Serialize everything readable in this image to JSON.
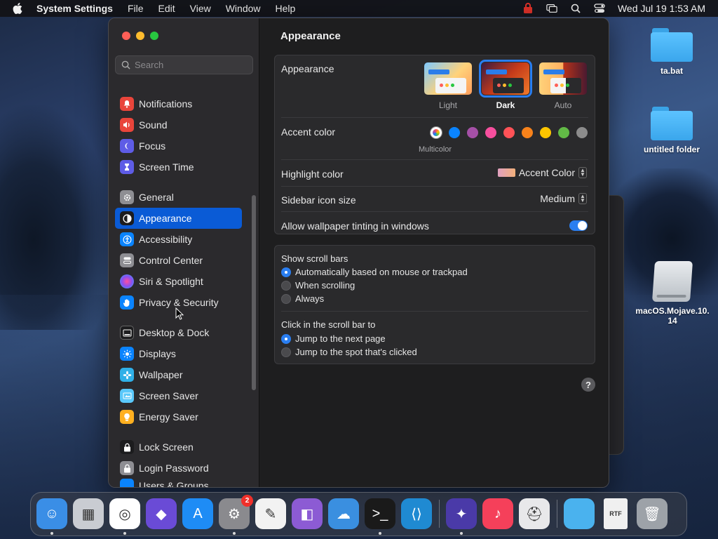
{
  "menubar": {
    "app_name": "System Settings",
    "items": [
      "File",
      "Edit",
      "View",
      "Window",
      "Help"
    ],
    "clock": "Wed Jul 19  1:53 AM"
  },
  "desktop": {
    "icons": [
      {
        "label": "ta.bat"
      },
      {
        "label": "untitled folder"
      },
      {
        "label": "macOS.Mojave.10.14"
      }
    ]
  },
  "sidebar": {
    "search_placeholder": "Search",
    "groups": [
      [
        {
          "label": "Notifications",
          "color": "#e9453b",
          "icon": "bell-icon"
        },
        {
          "label": "Sound",
          "color": "#e9453b",
          "icon": "speaker-icon"
        },
        {
          "label": "Focus",
          "color": "#5e5ce6",
          "icon": "moon-icon"
        },
        {
          "label": "Screen Time",
          "color": "#5e5ce6",
          "icon": "hourglass-icon"
        }
      ],
      [
        {
          "label": "General",
          "color": "#8e8e93",
          "icon": "gear-icon"
        },
        {
          "label": "Appearance",
          "color": "#1c1c1e",
          "icon": "appearance-icon",
          "active": true
        },
        {
          "label": "Accessibility",
          "color": "#0a84ff",
          "icon": "accessibility-icon"
        },
        {
          "label": "Control Center",
          "color": "#8e8e93",
          "icon": "toggles-icon"
        },
        {
          "label": "Siri & Spotlight",
          "color": "#bf5af2",
          "icon": "siri-icon"
        },
        {
          "label": "Privacy & Security",
          "color": "#0a84ff",
          "icon": "hand-icon"
        }
      ],
      [
        {
          "label": "Desktop & Dock",
          "color": "#1c1c1e",
          "icon": "dock-icon"
        },
        {
          "label": "Displays",
          "color": "#0a84ff",
          "icon": "sun-icon"
        },
        {
          "label": "Wallpaper",
          "color": "#30b0e8",
          "icon": "flower-icon"
        },
        {
          "label": "Screen Saver",
          "color": "#5ac8fa",
          "icon": "screensaver-icon"
        },
        {
          "label": "Energy Saver",
          "color": "#ffb020",
          "icon": "bulb-icon"
        }
      ],
      [
        {
          "label": "Lock Screen",
          "color": "#1c1c1e",
          "icon": "lock-icon"
        },
        {
          "label": "Login Password",
          "color": "#8e8e93",
          "icon": "padlock-icon"
        },
        {
          "label": "Users & Groups",
          "color": "#0a84ff",
          "icon": "users-icon"
        }
      ]
    ]
  },
  "content": {
    "title": "Appearance",
    "appearance_label": "Appearance",
    "themes": [
      {
        "label": "Light"
      },
      {
        "label": "Dark",
        "selected": true
      },
      {
        "label": "Auto"
      }
    ],
    "accent_label": "Accent color",
    "accent_colors": [
      "multicolor",
      "#0a84ff",
      "#a550a7",
      "#f74f9e",
      "#ff5257",
      "#f7821b",
      "#ffc600",
      "#62ba46",
      "#8c8c8c"
    ],
    "accent_caption": "Multicolor",
    "highlight_label": "Highlight color",
    "highlight_value": "Accent Color",
    "sidebar_icon_label": "Sidebar icon size",
    "sidebar_icon_value": "Medium",
    "tinting_label": "Allow wallpaper tinting in windows",
    "tinting_on": true,
    "scrollbars_label": "Show scroll bars",
    "scrollbar_options": [
      {
        "label": "Automatically based on mouse or trackpad",
        "on": true
      },
      {
        "label": "When scrolling",
        "on": false
      },
      {
        "label": "Always",
        "on": false
      }
    ],
    "click_label": "Click in the scroll bar to",
    "click_options": [
      {
        "label": "Jump to the next page",
        "on": true
      },
      {
        "label": "Jump to the spot that's clicked",
        "on": false
      }
    ],
    "help": "?"
  },
  "dock": {
    "items": [
      {
        "name": "Finder",
        "color": "#3a8ee6",
        "glyph": "☺",
        "running": true
      },
      {
        "name": "Launchpad",
        "color": "#c9ccd2",
        "glyph": "▦",
        "running": false
      },
      {
        "name": "Chrome",
        "color": "#ffffff",
        "glyph": "◎",
        "running": true
      },
      {
        "name": "Shortcuts",
        "color": "#6a4bd6",
        "glyph": "◆",
        "running": false
      },
      {
        "name": "App Store",
        "color": "#1e8cf5",
        "glyph": "A",
        "running": false
      },
      {
        "name": "System Settings",
        "color": "#8a8a8e",
        "glyph": "⚙",
        "running": true,
        "badge": "2"
      },
      {
        "name": "TextEdit",
        "color": "#f2f2f2",
        "glyph": "✎",
        "running": false
      },
      {
        "name": "Visual Studio",
        "color": "#8c5bd4",
        "glyph": "◧",
        "running": false
      },
      {
        "name": "Weather",
        "color": "#3a8fe0",
        "glyph": "☁",
        "running": false
      },
      {
        "name": "Terminal",
        "color": "#1a1a1a",
        "glyph": ">_",
        "running": true
      },
      {
        "name": "VS Code",
        "color": "#1f8ad2",
        "glyph": "⟨⟩",
        "running": false
      },
      {
        "name": "Helper",
        "color": "#4a3aa8",
        "glyph": "✦",
        "running": true
      },
      {
        "name": "Music",
        "color": "#f5405a",
        "glyph": "♪",
        "running": false
      },
      {
        "name": "Disk Utility",
        "color": "#e8e8ea",
        "glyph": "⛑",
        "running": false
      },
      {
        "name": "Folder",
        "color": "#4ab2ee",
        "glyph": "",
        "running": false
      },
      {
        "name": "RTF Document",
        "color": "#f0f0f0",
        "glyph": "RTF",
        "running": false
      },
      {
        "name": "Trash",
        "color": "#9da2a8",
        "glyph": "🗑",
        "running": false
      }
    ]
  }
}
